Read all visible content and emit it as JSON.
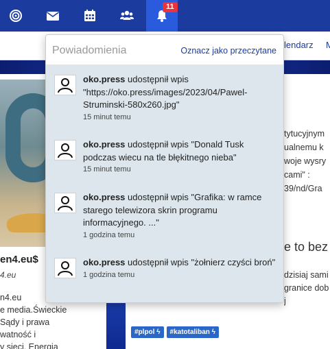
{
  "navbar": {
    "notifications_badge": "11"
  },
  "subnav": {
    "link1": "lendarz",
    "link2": "M"
  },
  "background": {
    "profile_name": "en4.eu$",
    "profile_sub": "4.eu",
    "profile_text": [
      "n4.eu",
      "e media.Świeckie",
      "Sądy i prawa",
      "watność i",
      "y sieci. Energia"
    ],
    "right_lines": [
      "tytucyjnym",
      "ualnemu k",
      "woje wysry",
      "cami\" :",
      "39/nd/Gra"
    ],
    "right_heading": "e to bez",
    "right_lines2": [
      "dzisiaj sami",
      "granice dob",
      "j"
    ],
    "tags": [
      "#plpol ϟ",
      "#katotaliban ϟ"
    ]
  },
  "dropdown": {
    "title": "Powiadomienia",
    "mark_read": "Oznacz jako przeczytane",
    "items": [
      {
        "user": "oko.press",
        "action": " udostępnił wpis \"https://oko.press/images/2023/04/Pawel-Struminski-580x260.jpg\"",
        "time": "15 minut temu"
      },
      {
        "user": "oko.press",
        "action": " udostępnił wpis \"Donald Tusk podczas wiecu na tle błękitnego nieba\"",
        "time": "15 minut temu"
      },
      {
        "user": "oko.press",
        "action": " udostępnił wpis \"Grafika: w ramce starego telewizora skrin programu informacyjnego. ...\"",
        "time": "1 godzina temu"
      },
      {
        "user": "oko.press",
        "action": " udostępnił wpis \"żołnierz czyści broń\"",
        "time": "1 godzina temu"
      }
    ]
  }
}
